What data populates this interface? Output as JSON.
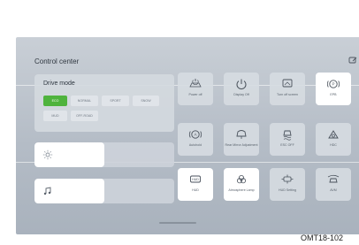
{
  "header": {
    "title": "Control center",
    "edit_icon": "edit-icon"
  },
  "drive_mode": {
    "title": "Drive mode",
    "active": "ECO",
    "modes": [
      "ECO",
      "NORMAL",
      "SPORT",
      "SNOW",
      "MUD",
      "OFF-ROAD"
    ]
  },
  "brightness": {
    "icon": "sun-icon",
    "level_percent": 50
  },
  "volume": {
    "icon": "music-note-icon",
    "level_percent": 50
  },
  "tiles": [
    {
      "label": "Power off",
      "icon": "car-power-icon",
      "on": false
    },
    {
      "label": "Display Off",
      "icon": "power-icon",
      "on": false
    },
    {
      "label": "Turn off screen",
      "icon": "screen-off-icon",
      "on": false
    },
    {
      "label": "EPB",
      "icon": "epb-icon",
      "on": true
    },
    {
      "label": "Autohold",
      "icon": "autohold-icon",
      "on": false
    },
    {
      "label": "Rear Mirror Adjustment",
      "icon": "mirror-icon",
      "on": false
    },
    {
      "label": "ESC OFF",
      "icon": "esc-icon",
      "on": false
    },
    {
      "label": "HDC",
      "icon": "hdc-icon",
      "on": false
    },
    {
      "label": "HUD",
      "icon": "hud-icon",
      "on": true
    },
    {
      "label": "Atmosphere Lamp",
      "icon": "atmosphere-lamp-icon",
      "on": true
    },
    {
      "label": "HUD Setting",
      "icon": "hud-setting-icon",
      "on": false
    },
    {
      "label": "AVM",
      "icon": "avm-icon",
      "on": false
    }
  ],
  "colors": {
    "active_mode": "#4fb33d",
    "tile_on": "#ffffff"
  },
  "figure_code": "OMT18-102"
}
